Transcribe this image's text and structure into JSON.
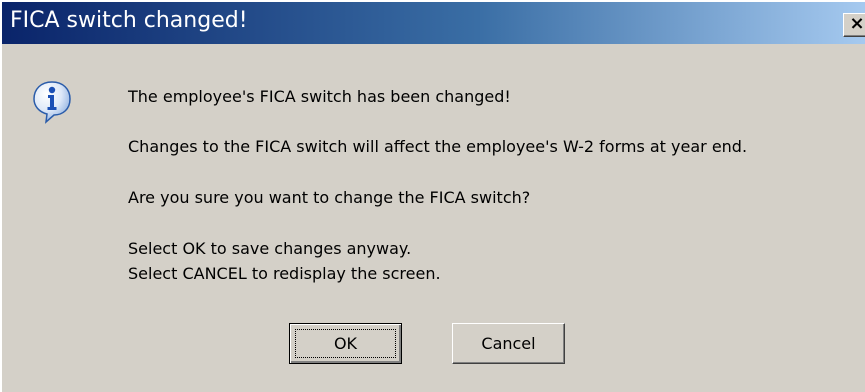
{
  "dialog": {
    "title": "FICA switch changed!",
    "close_glyph": "×",
    "icon": "information-icon",
    "messages": {
      "line1": "The employee's FICA switch has been changed!",
      "line2": "Changes to the FICA switch will affect the employee's W-2 forms at year end.",
      "line3": "Are you sure you want to change the FICA switch?",
      "line4": "Select OK to save changes anyway.",
      "line5": "Select CANCEL to redisplay the screen."
    },
    "buttons": {
      "ok_label": "OK",
      "cancel_label": "Cancel"
    }
  },
  "colors": {
    "title_gradient_start": "#0a246a",
    "title_gradient_end": "#a6caf0",
    "dialog_background": "#d4d0c8",
    "icon_blue": "#2a6cc8"
  }
}
